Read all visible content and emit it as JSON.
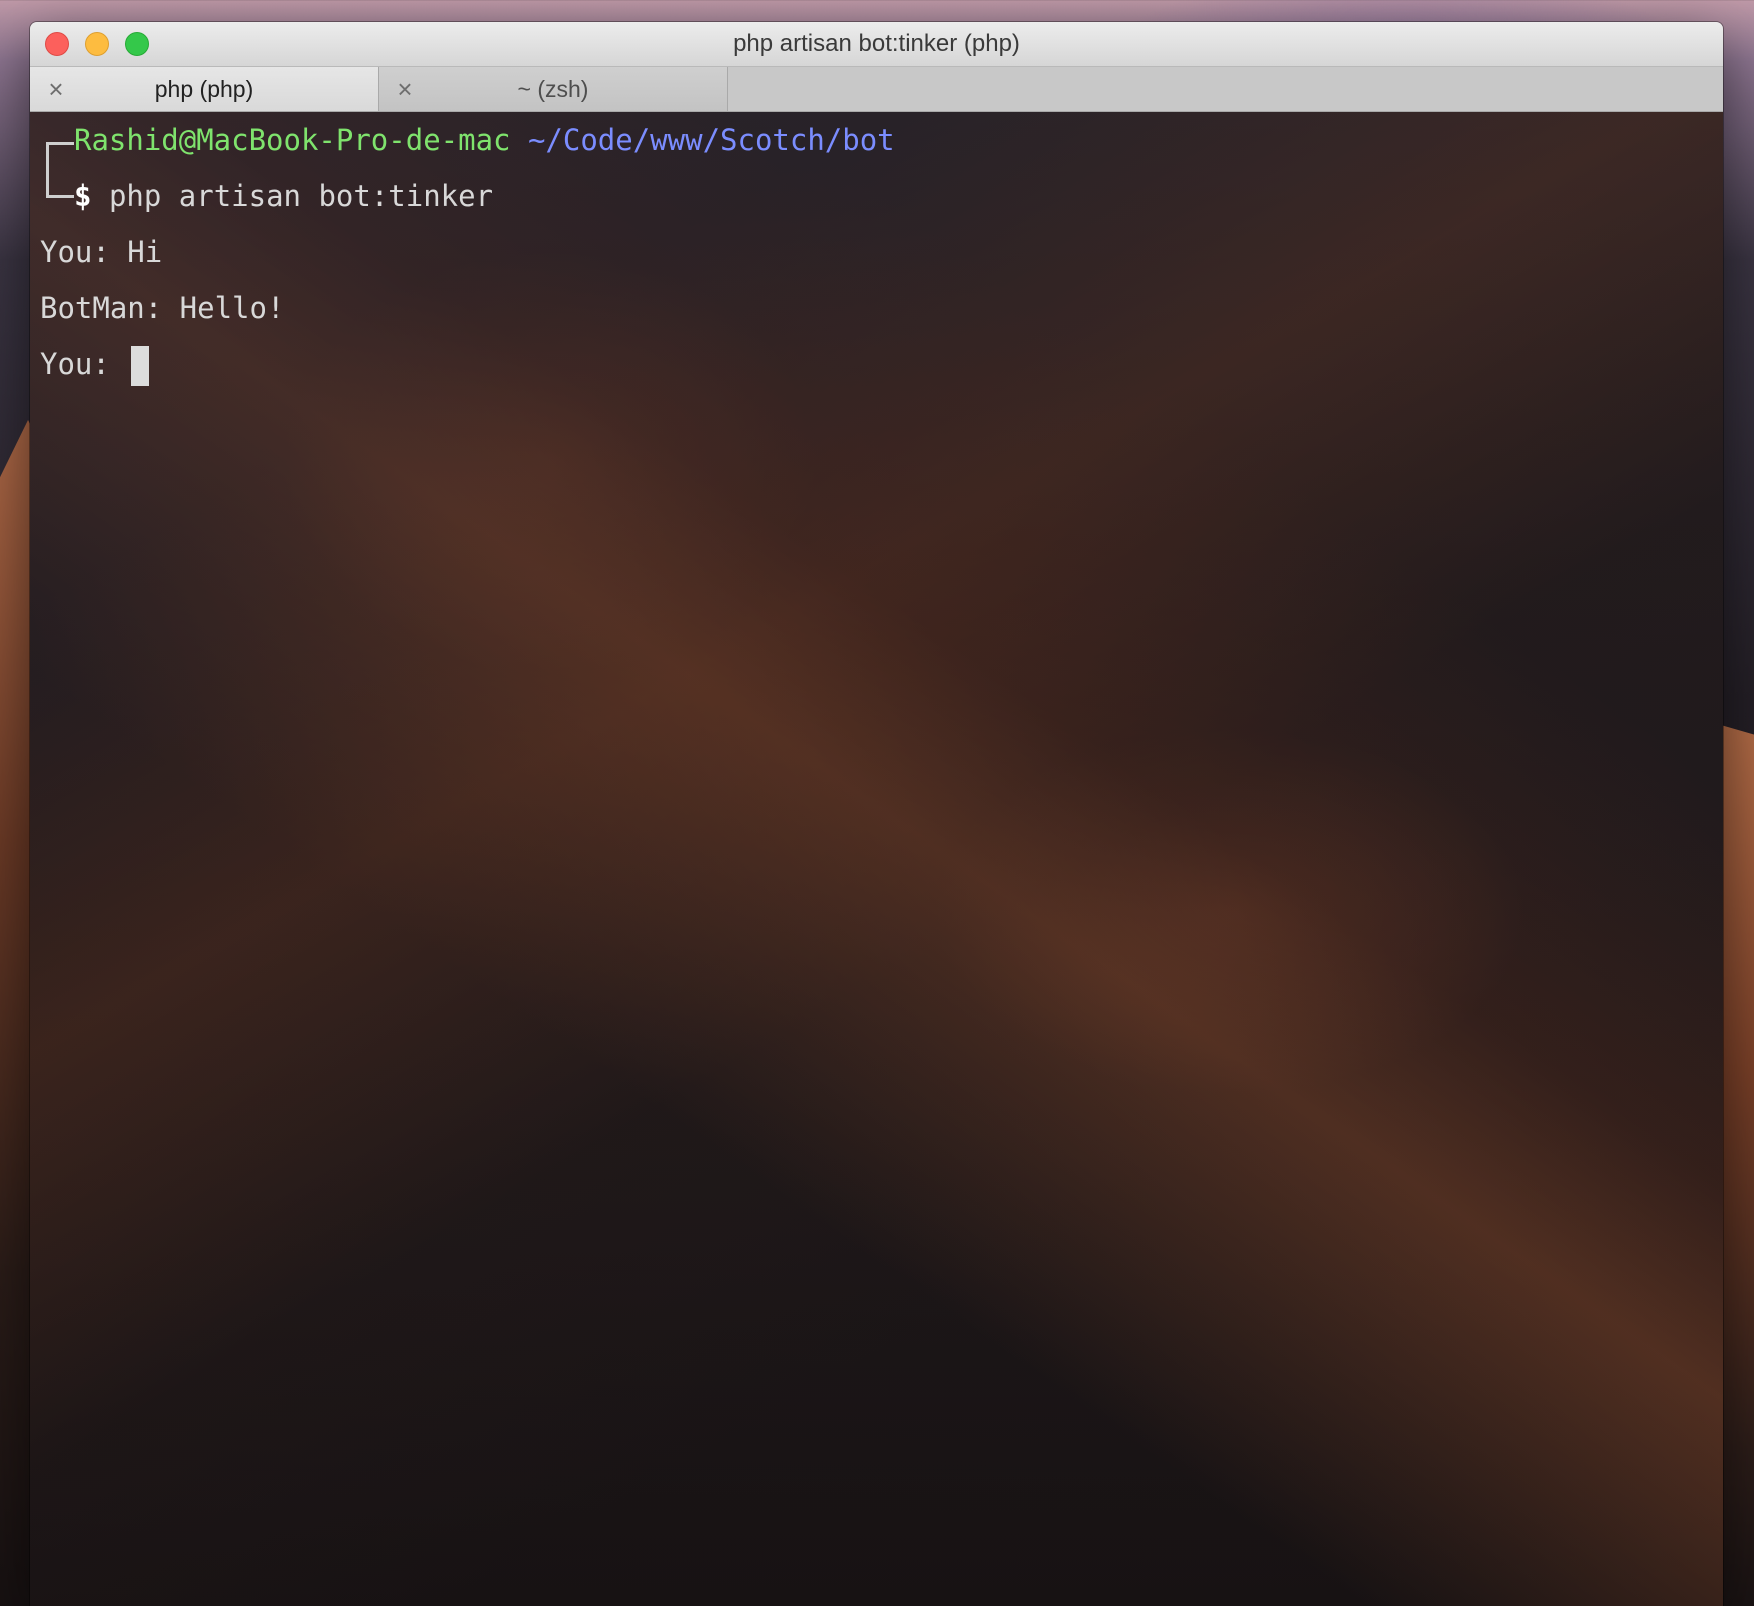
{
  "window": {
    "title": "php artisan bot:tinker (php)"
  },
  "tabs": [
    {
      "label": "php (php)",
      "active": true,
      "close_icon": "close-icon"
    },
    {
      "label": "~ (zsh)",
      "active": false,
      "close_icon": "close-icon"
    }
  ],
  "terminal": {
    "prompt": {
      "user_host": "Rashid@MacBook-Pro-de-mac",
      "cwd": "~/Code/www/Scotch/bot",
      "symbol": "$",
      "command": "php artisan bot:tinker"
    },
    "lines": [
      "You: Hi",
      "BotMan: Hello!",
      "You: "
    ]
  },
  "colors": {
    "user_host": "#7fe36d",
    "cwd": "#7b8dff",
    "text": "#d8d8d8",
    "close_light": "#fc605c",
    "minimize_light": "#fdbc40",
    "zoom_light": "#34c84a"
  }
}
